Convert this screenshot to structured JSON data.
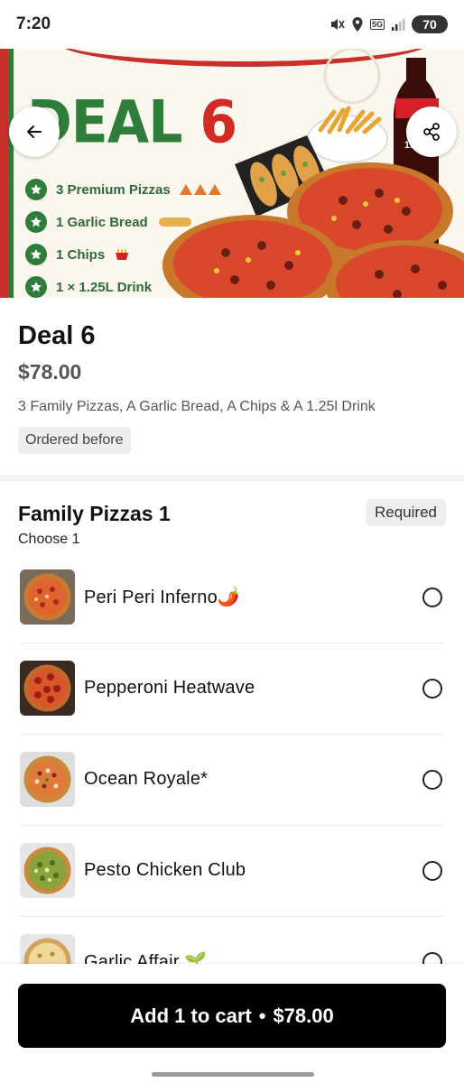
{
  "status_bar": {
    "time": "7:20",
    "network": "5G",
    "battery": "70",
    "icons": [
      "mute-vibrate-icon",
      "location-icon",
      "signal-icon",
      "battery-icon"
    ]
  },
  "hero": {
    "deal_word": "DEAL",
    "deal_number": "6",
    "items": [
      "3 Premium Pizzas",
      "1 Garlic Bread",
      "1 Chips",
      "1 × 1.25L Drink"
    ],
    "bottle_label": "1.25L",
    "back_icon": "arrow-left-icon",
    "share_icon": "share-icon"
  },
  "item": {
    "title": "Deal 6",
    "price": "$78.00",
    "description": "3 Family Pizzas, A Garlic Bread, A Chips & A 1.25l Drink",
    "badge": "Ordered before"
  },
  "section": {
    "title": "Family Pizzas 1",
    "subtitle": "Choose 1",
    "required_label": "Required",
    "options": [
      {
        "label": "Peri Peri Inferno🌶️"
      },
      {
        "label": "Pepperoni Heatwave"
      },
      {
        "label": "Ocean Royale*"
      },
      {
        "label": "Pesto Chicken Club"
      },
      {
        "label": "Garlic Affair 🌱"
      }
    ]
  },
  "footer": {
    "cart_label": "Add 1 to cart",
    "separator": "•",
    "cart_price": "$78.00"
  },
  "colors": {
    "deal_green": "#2f7d3a",
    "deal_red": "#d12b24",
    "button_black": "#000000"
  }
}
